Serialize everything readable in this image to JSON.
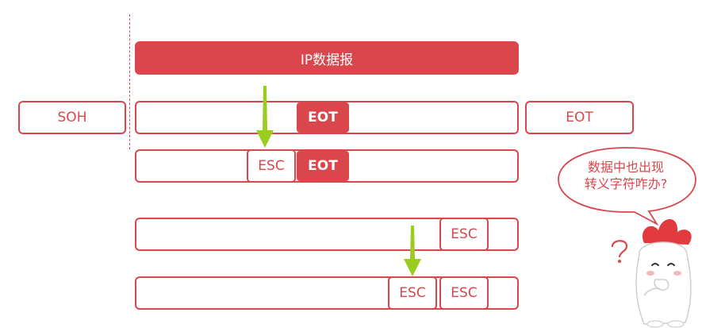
{
  "header": {
    "label": "IP数据报"
  },
  "frame_start": {
    "label": "SOH"
  },
  "frame_end": {
    "label": "EOT"
  },
  "rows": {
    "r1": {
      "eot": "EOT"
    },
    "r2": {
      "esc": "ESC",
      "eot": "EOT"
    },
    "r3": {
      "esc": "ESC"
    },
    "r4": {
      "esc_inserted": "ESC",
      "esc_original": "ESC"
    }
  },
  "speech_bubble": {
    "line1": "数据中也出现",
    "line2": "转义字符咋办?"
  },
  "colors": {
    "accent": "#d9474c",
    "arrow": "#9acd1d",
    "background": "#ffffff"
  },
  "icons": {
    "arrow": "down-arrow-icon",
    "mascot": "mascot-character-icon",
    "question": "question-mark-icon"
  }
}
